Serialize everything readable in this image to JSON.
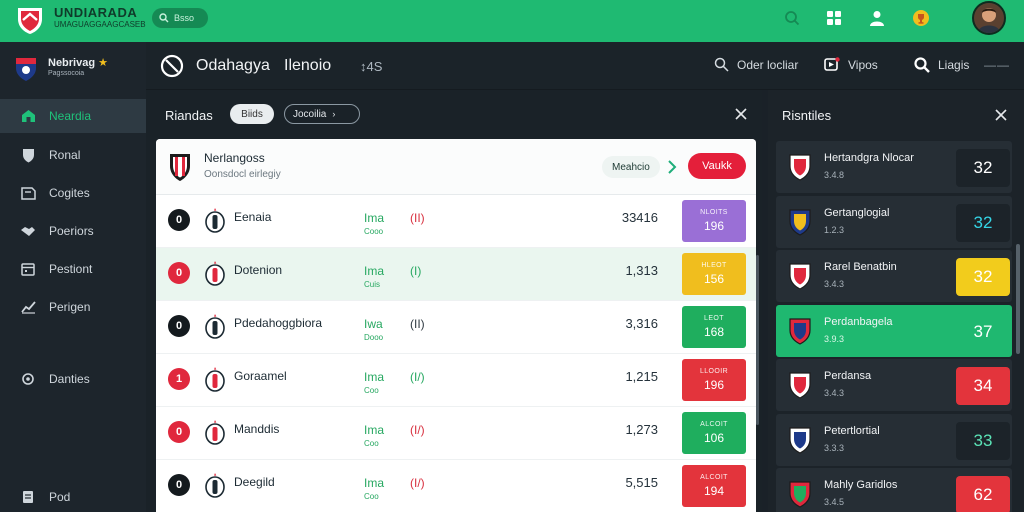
{
  "topbar": {
    "brand_title": "UNDIARADA",
    "brand_sub": "UMAGUAGGAAGCASEB",
    "search_text": "Bsso",
    "icons": [
      "search-icon",
      "grid-icon",
      "user-icon",
      "trophy-icon"
    ],
    "accent": "#1fba72"
  },
  "sidebar": {
    "brand_title": "Nebrivag",
    "brand_sub": "Pagssocoia",
    "items": [
      {
        "label": "Neardia",
        "icon": "home-icon",
        "active": true
      },
      {
        "label": "Ronal",
        "icon": "shield-icon",
        "active": false
      },
      {
        "label": "Cogites",
        "icon": "flag-icon",
        "active": false
      },
      {
        "label": "Poeriors",
        "icon": "handshake-icon",
        "active": false
      },
      {
        "label": "Pestiont",
        "icon": "calendar-icon",
        "active": false
      },
      {
        "label": "Perigen",
        "icon": "chart-icon",
        "active": false
      },
      {
        "label": "Danties",
        "icon": "ring-icon",
        "active": false
      },
      {
        "label": "Pod",
        "icon": "document-icon",
        "active": false
      }
    ]
  },
  "header": {
    "title": "Odahagya",
    "title2": "Ilenoio",
    "meta": "4S",
    "actions": [
      {
        "label": "Oder locliar",
        "icon": "search-icon"
      },
      {
        "label": "Vipos",
        "icon": "video-icon"
      },
      {
        "label": "Liagis",
        "icon": "magnifier-icon"
      }
    ],
    "dots": "——"
  },
  "results": {
    "title": "Riandas",
    "chip_light": "Biids",
    "chip_dark": "Jocoilia",
    "card_head": {
      "title": "Nerlangoss",
      "sub": "Oonsdocl eirlegiy",
      "link": "Meahcio",
      "button": "Vaukk"
    },
    "rows": [
      {
        "num": "0",
        "num_color": "#141a1e",
        "name": "Eenaia",
        "tag": "Ima",
        "tag_sub": "Cooo",
        "tag_color": "#27a861",
        "form": "(II)",
        "form_color": "#d8303f",
        "value": "33416",
        "badge_label": "NLOITS",
        "badge_value": "196",
        "badge_color": "#9a6fd6",
        "highlight": false
      },
      {
        "num": "0",
        "num_color": "#e0283d",
        "name": "Dotenion",
        "tag": "Ima",
        "tag_sub": "Cuis",
        "tag_color": "#27a861",
        "form": "(I)",
        "form_color": "#27a861",
        "value": "1,313",
        "badge_label": "HLEOT",
        "badge_value": "156",
        "badge_color": "#f0be1e",
        "highlight": true
      },
      {
        "num": "0",
        "num_color": "#141a1e",
        "name": "Pdedahoggbiora",
        "tag": "Iwa",
        "tag_sub": "Dooo",
        "tag_color": "#27a861",
        "form": "(II)",
        "form_color": "#2f3a42",
        "value": "3,316",
        "badge_label": "LEOT",
        "badge_value": "168",
        "badge_color": "#1fae5e",
        "highlight": false
      },
      {
        "num": "1",
        "num_color": "#e0283d",
        "name": "Goraamel",
        "tag": "Ima",
        "tag_sub": "Coo",
        "tag_color": "#27a861",
        "form": "(I/)",
        "form_color": "#27a861",
        "value": "1,215",
        "badge_label": "LLOOIR",
        "badge_value": "196",
        "badge_color": "#e3343c",
        "highlight": false
      },
      {
        "num": "0",
        "num_color": "#e0283d",
        "name": "Manddis",
        "tag": "Ima",
        "tag_sub": "Coo",
        "tag_color": "#27a861",
        "form": "(I/)",
        "form_color": "#d8303f",
        "value": "1,273",
        "badge_label": "ALCOIT",
        "badge_value": "106",
        "badge_color": "#1fae5e",
        "highlight": false
      },
      {
        "num": "0",
        "num_color": "#141a1e",
        "name": "Deegild",
        "tag": "Ima",
        "tag_sub": "Coo",
        "tag_color": "#27a861",
        "form": "(I/)",
        "form_color": "#d8303f",
        "value": "5,515",
        "badge_label": "ALCOIT",
        "badge_value": "194",
        "badge_color": "#e3343c",
        "highlight": false
      }
    ]
  },
  "right": {
    "title": "Risntiles",
    "cards": [
      {
        "name": "Hertandgra Nlocar",
        "sub": "3.4.8",
        "score": "32",
        "score_bg": "#1c2329",
        "score_color": "#ffffff",
        "active": false,
        "crest_colors": [
          "#e0283d",
          "#ffffff"
        ]
      },
      {
        "name": "Gertanglogial",
        "sub": "1.2.3",
        "score": "32",
        "score_bg": "#1c2329",
        "score_color": "#35d5e6",
        "active": false,
        "crest_colors": [
          "#f0be1e",
          "#1e3a8a"
        ]
      },
      {
        "name": "Rarel Benatbin",
        "sub": "3.4.3",
        "score": "32",
        "score_bg": "#f2cc1c",
        "score_color": "#ffffff",
        "active": false,
        "crest_colors": [
          "#e0283d",
          "#ffffff"
        ]
      },
      {
        "name": "Perdanbagela",
        "sub": "3.9.3",
        "score": "37",
        "score_bg": "#1fb870",
        "score_color": "#ffffff",
        "active": true,
        "crest_colors": [
          "#1e3a8a",
          "#e0283d"
        ]
      },
      {
        "name": "Perdansa",
        "sub": "3.4.3",
        "score": "34",
        "score_bg": "#e3343c",
        "score_color": "#ffffff",
        "active": false,
        "crest_colors": [
          "#e0283d",
          "#ffffff"
        ]
      },
      {
        "name": "Petertlortial",
        "sub": "3.3.3",
        "score": "33",
        "score_bg": "#1c2329",
        "score_color": "#5be3b6",
        "active": false,
        "crest_colors": [
          "#1e3a8a",
          "#ffffff"
        ]
      },
      {
        "name": "Mahly Garidlos",
        "sub": "3.4.5",
        "score": "62",
        "score_bg": "#e3343c",
        "score_color": "#ffffff",
        "active": false,
        "crest_colors": [
          "#1fae5e",
          "#e0283d"
        ]
      }
    ]
  }
}
